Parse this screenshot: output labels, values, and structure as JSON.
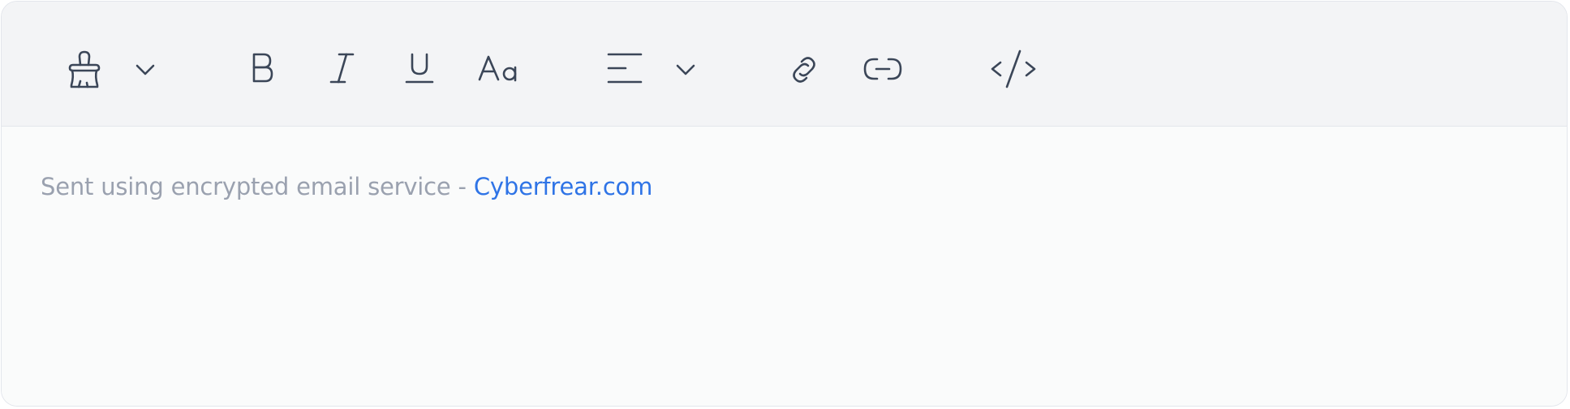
{
  "toolbar": {
    "tools": [
      {
        "name": "format-painter",
        "icon": "paint-brush-icon"
      },
      {
        "name": "format-painter-dropdown",
        "icon": "chevron-down-icon"
      },
      {
        "name": "bold",
        "icon": "bold-icon"
      },
      {
        "name": "italic",
        "icon": "italic-icon"
      },
      {
        "name": "underline",
        "icon": "underline-icon"
      },
      {
        "name": "font-size",
        "icon": "font-size-icon",
        "label": "Aa"
      },
      {
        "name": "align",
        "icon": "align-left-icon"
      },
      {
        "name": "align-dropdown",
        "icon": "chevron-down-icon"
      },
      {
        "name": "insert-link",
        "icon": "link-icon"
      },
      {
        "name": "unlink",
        "icon": "unlink-icon"
      },
      {
        "name": "code",
        "icon": "code-icon"
      }
    ],
    "icon_color": "#3b4658"
  },
  "content": {
    "signature_text": "Sent using encrypted email service - ",
    "signature_link": "Cyberfrear.com",
    "text_color": "#9aa1af",
    "link_color": "#2f74e6"
  }
}
